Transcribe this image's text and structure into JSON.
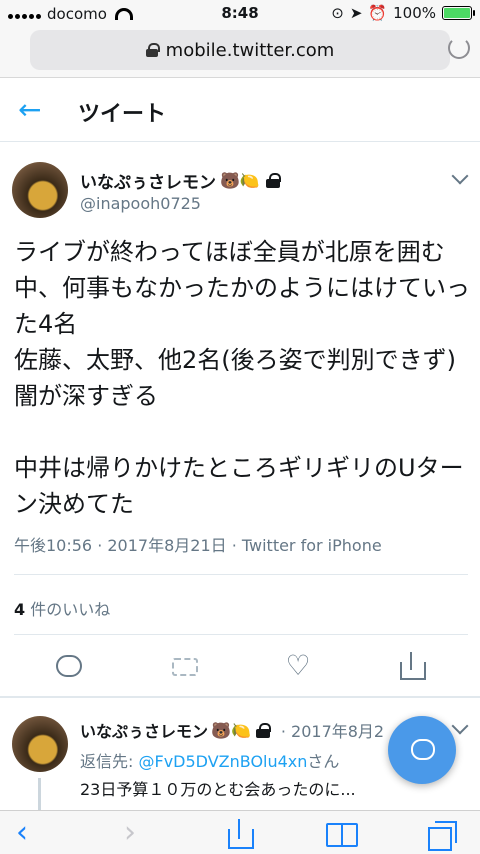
{
  "status_bar": {
    "carrier": "docomo",
    "time": "8:48",
    "battery": "100%",
    "battery_level": 1.0
  },
  "browser": {
    "url": "mobile.twitter.com"
  },
  "header": {
    "back": "←",
    "title": "ツイート"
  },
  "tweet": {
    "name": "いなぷぅさレモン",
    "name_emojis": "🐻🍋",
    "handle": "@inapooh0725",
    "text": "ライブが終わってほぼ全員が北原を囲む中、何事もなかったかのようにはけていった4名\n佐藤、太野、他2名(後ろ姿で判別できず)闇が深すぎる\n\n中井は帰りかけたところギリギリのUターン決めてた",
    "meta": "午後10:56 · 2017年8月21日 · Twitter for iPhone",
    "likes_count": "4",
    "likes_label": " 件のいいね"
  },
  "reply": {
    "name": "いなぷぅさレモン",
    "name_emojis": "🐻🍋",
    "date": "· 2017年8月2",
    "reply_to_label": "返信先: ",
    "reply_to_mention": "@FvD5DVZnBOlu4xn",
    "reply_to_suffix": "さん",
    "text": "23日予算１０万のとむ会あったのに..."
  },
  "toolbar": {
    "back": "‹",
    "forward": "›"
  },
  "colors": {
    "accent": "#1da1f2",
    "fab": "#4a99e9",
    "safari_blue": "#1a82fb"
  }
}
